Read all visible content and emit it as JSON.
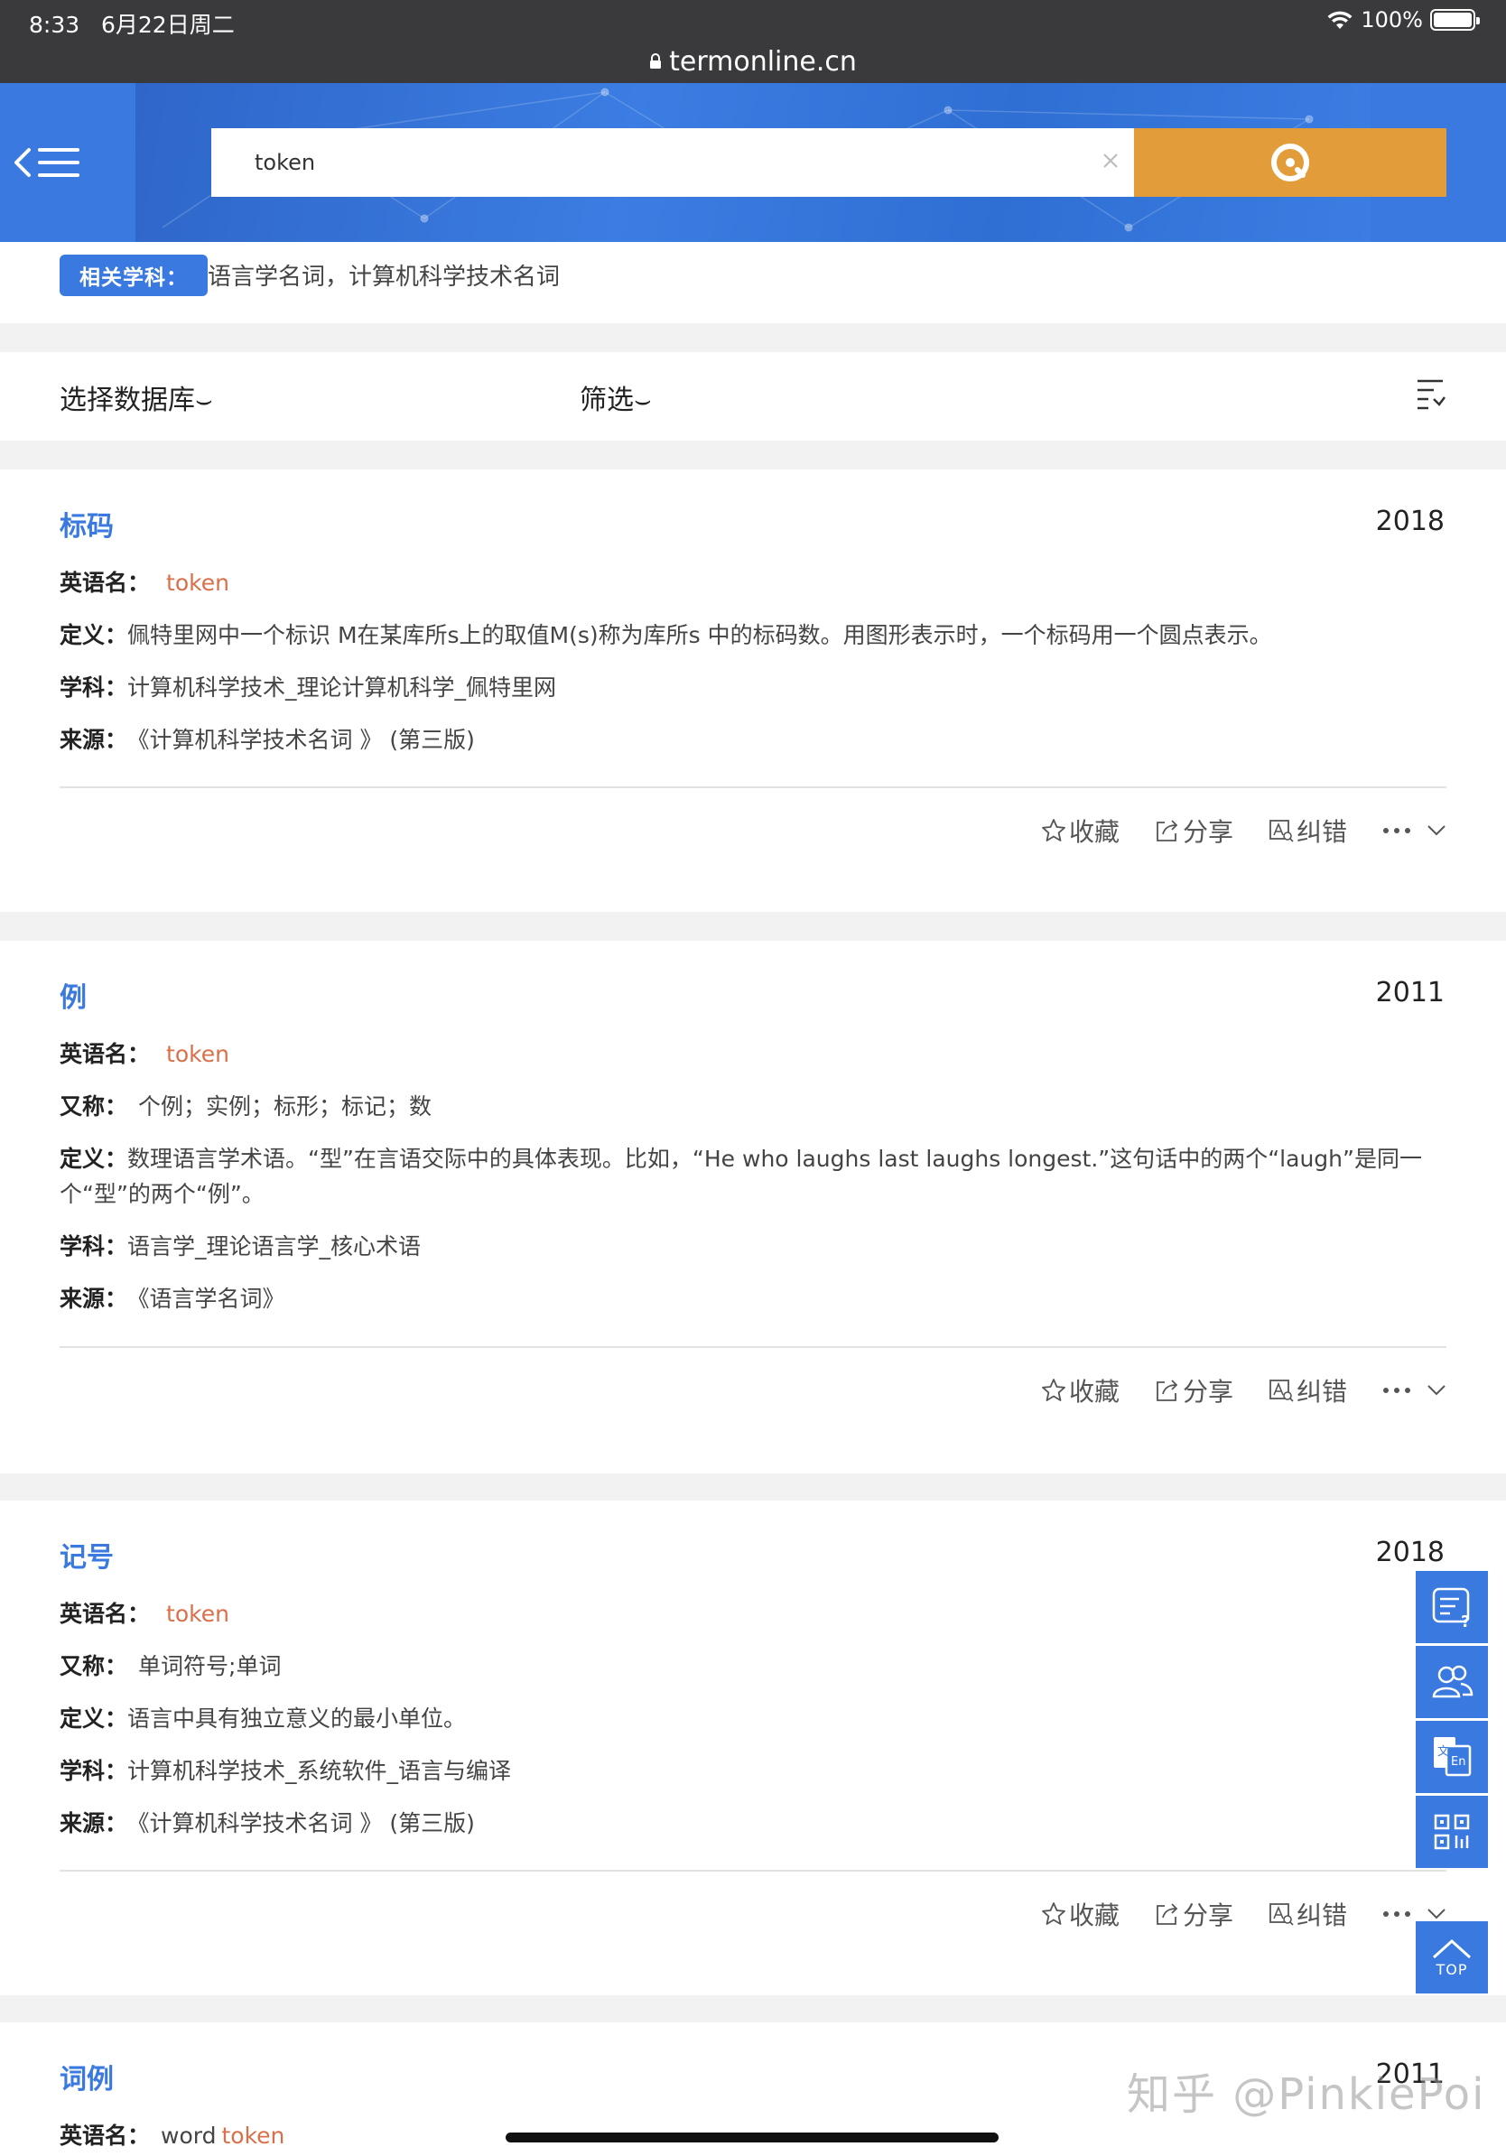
{
  "status": {
    "time": "8:33",
    "date": "6月22日周二",
    "battery": "100%"
  },
  "browser": {
    "url": "termonline.cn"
  },
  "header": {
    "search_value": "token"
  },
  "related": {
    "tag": "相关学科：",
    "text": "语言学名词，计算机科学技术名词"
  },
  "filters": {
    "database": "选择数据库",
    "screen": "筛选"
  },
  "actions": {
    "collect": "收藏",
    "share": "分享",
    "report": "纠错"
  },
  "entries": [
    {
      "title": "标码",
      "year": "2018",
      "english_label": "英语名：",
      "english": "token",
      "definition_label": "定义：",
      "definition": "佩特里网中一个标识 M在某库所s上的取值M(s)称为库所s 中的标码数。用图形表示时，一个标码用一个圆点表示。",
      "subject_label": "学科：",
      "subject": "计算机科学技术_理论计算机科学_佩特里网",
      "source_label": "来源：",
      "source": "《计算机科学技术名词 》 (第三版)"
    },
    {
      "title": "例",
      "year": "2011",
      "english_label": "英语名：",
      "english": "token",
      "alias_label": "又称：",
      "alias": "个例；实例；标形；标记；数",
      "definition_label": "定义：",
      "definition": "数理语言学术语。“型”在言语交际中的具体表现。比如，“He who laughs last laughs longest.”这句话中的两个“laugh”是同一个“型”的两个“例”。",
      "subject_label": "学科：",
      "subject": "语言学_理论语言学_核心术语",
      "source_label": "来源：",
      "source": "《语言学名词》"
    },
    {
      "title": "记号",
      "year": "2018",
      "english_label": "英语名：",
      "english": "token",
      "alias_label": "又称：",
      "alias": "单词符号;单词",
      "definition_label": "定义：",
      "definition": "语言中具有独立意义的最小单位。",
      "subject_label": "学科：",
      "subject": "计算机科学技术_系统软件_语言与编译",
      "source_label": "来源：",
      "source": "《计算机科学技术名词 》 (第三版)"
    },
    {
      "title": "词例",
      "year": "2011",
      "english_label": "英语名：",
      "english_prefix": "word",
      "english": "token"
    }
  ],
  "side_tools": {
    "top_label": "TOP"
  },
  "watermark": "知乎 @PinkiePoi",
  "icons": [
    "wifi-icon",
    "battery-icon",
    "lock-icon",
    "menu-icon",
    "clear-icon",
    "search-icon",
    "sort-icon",
    "star-icon",
    "share-icon",
    "report-icon",
    "more-icon",
    "chevron-down-icon",
    "feedback-icon",
    "users-icon",
    "translate-icon",
    "qrcode-icon",
    "top-icon"
  ],
  "colors": {
    "brand_blue": "#3a7ae0",
    "search_orange": "#e39c3a",
    "english_term": "#d9704a"
  }
}
